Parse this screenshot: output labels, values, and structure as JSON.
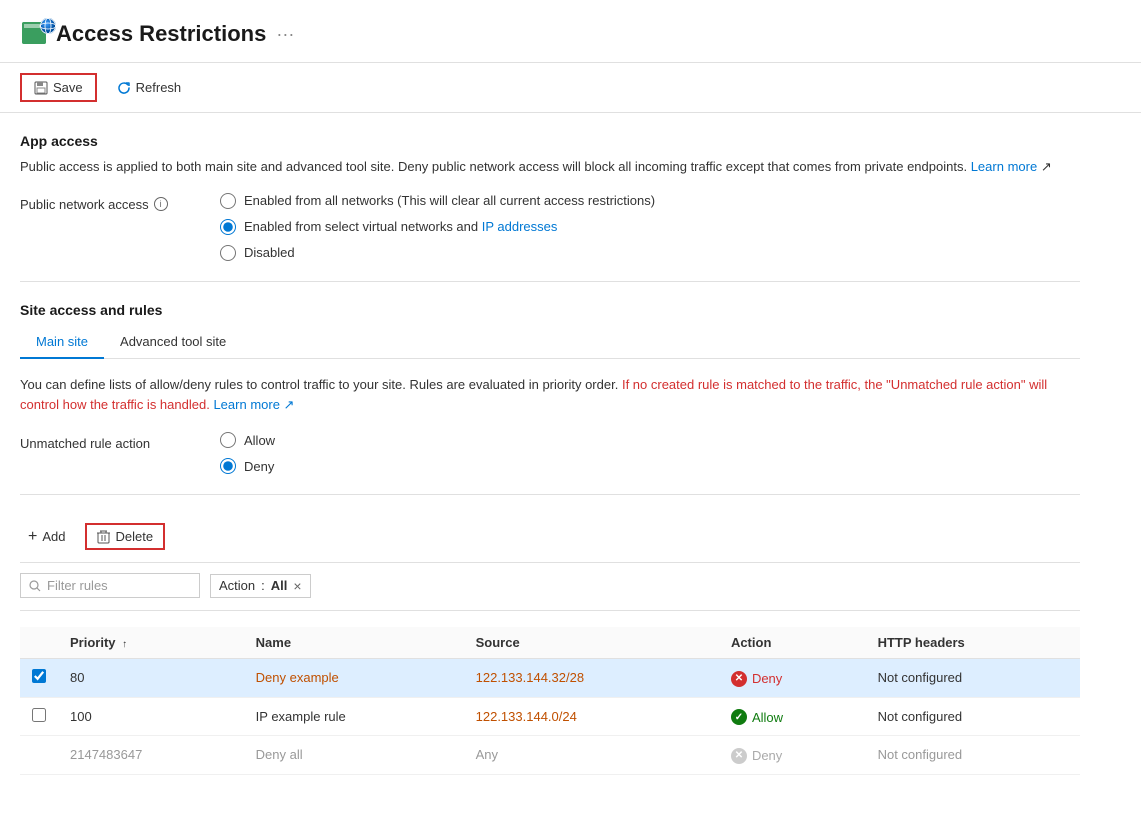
{
  "header": {
    "title": "Access Restrictions",
    "dots_label": "···"
  },
  "toolbar": {
    "save_label": "Save",
    "refresh_label": "Refresh"
  },
  "app_access": {
    "section_title": "App access",
    "info_text_before_link": "Public access is applied to both main site and advanced tool site. Deny public network access will block all incoming traffic except that comes from private endpoints.",
    "learn_more_label": "Learn more",
    "public_network_label": "Public network access",
    "info_icon": "i",
    "radio_options": [
      {
        "id": "radio-all",
        "label": "Enabled from all networks (This will clear all current access restrictions)",
        "checked": false
      },
      {
        "id": "radio-select",
        "label_before": "Enabled from select virtual networks and ",
        "label_link": "IP addresses",
        "checked": true
      },
      {
        "id": "radio-disabled",
        "label": "Disabled",
        "checked": false
      }
    ]
  },
  "site_access": {
    "section_title": "Site access and rules",
    "tabs": [
      {
        "id": "main-site",
        "label": "Main site",
        "active": true
      },
      {
        "id": "advanced-tool-site",
        "label": "Advanced tool site",
        "active": false
      }
    ],
    "description_before": "You can define lists of allow/deny rules to control traffic to your site. Rules are evaluated in priority order.",
    "description_highlight": " If no created rule is matched to the traffic, the \"Unmatched rule action\" will control how the traffic is handled.",
    "learn_more_label": "Learn more",
    "unmatched_label": "Unmatched rule action",
    "unmatched_options": [
      {
        "id": "unmatched-allow",
        "label": "Allow",
        "checked": false
      },
      {
        "id": "unmatched-deny",
        "label": "Deny",
        "checked": true
      }
    ]
  },
  "actions": {
    "add_label": "Add",
    "delete_label": "Delete"
  },
  "filter": {
    "placeholder": "Filter rules",
    "tag_label": "Action",
    "tag_separator": " : ",
    "tag_value": "All",
    "close_icon": "×"
  },
  "table": {
    "columns": [
      {
        "id": "checkbox",
        "label": ""
      },
      {
        "id": "priority",
        "label": "Priority",
        "sort": "asc"
      },
      {
        "id": "name",
        "label": "Name"
      },
      {
        "id": "source",
        "label": "Source"
      },
      {
        "id": "action",
        "label": "Action"
      },
      {
        "id": "http_headers",
        "label": "HTTP headers"
      }
    ],
    "rows": [
      {
        "selected": true,
        "priority": "80",
        "name": "Deny example",
        "name_link": true,
        "source": "122.133.144.32/28",
        "source_link": true,
        "action": "Deny",
        "action_type": "deny",
        "http_headers": "Not configured",
        "muted": false
      },
      {
        "selected": false,
        "priority": "100",
        "name": "IP example rule",
        "name_link": false,
        "source": "122.133.144.0/24",
        "source_link": true,
        "action": "Allow",
        "action_type": "allow",
        "http_headers": "Not configured",
        "muted": false
      },
      {
        "selected": false,
        "priority": "2147483647",
        "name": "Deny all",
        "name_link": false,
        "source": "Any",
        "source_link": false,
        "action": "Deny",
        "action_type": "deny-muted",
        "http_headers": "Not configured",
        "muted": true
      }
    ]
  }
}
